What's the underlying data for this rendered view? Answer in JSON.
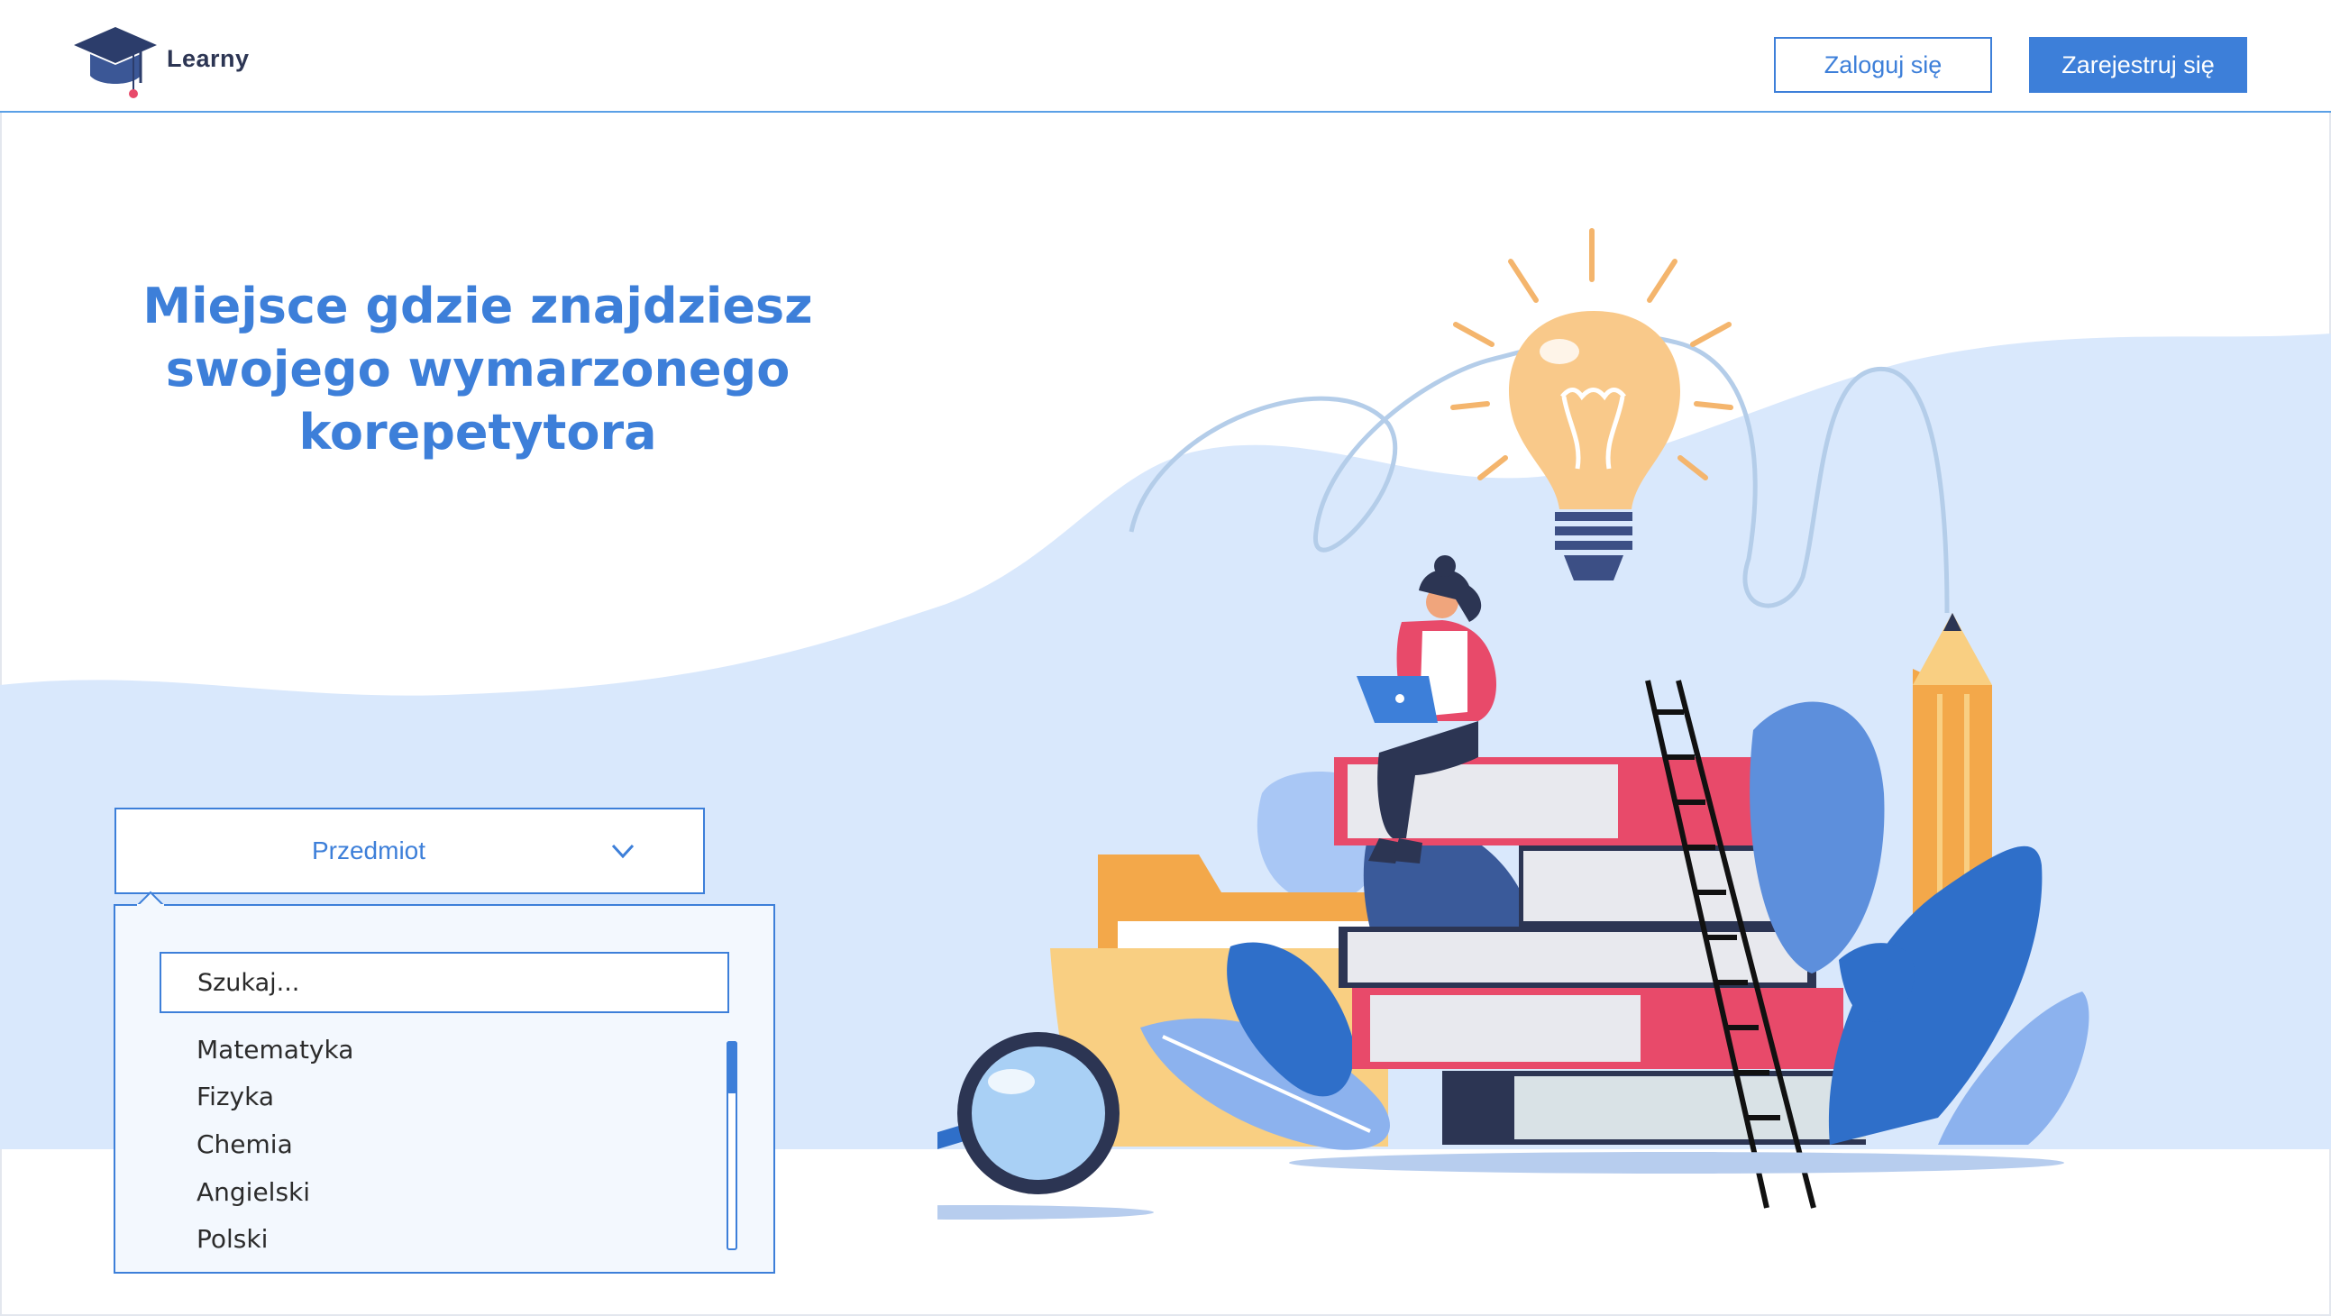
{
  "header": {
    "brand": "Learny",
    "login_label": "Zaloguj się",
    "register_label": "Zarejestruj się"
  },
  "hero": {
    "title_lines": [
      "Miejsce gdzie znajdziesz",
      "swojego wymarzonego",
      "korepetytora"
    ]
  },
  "subject_select": {
    "selected": "Przedmiot",
    "search_placeholder": "Szukaj...",
    "options": [
      "Matematyka",
      "Fizyka",
      "Chemia",
      "Angielski",
      "Polski"
    ]
  },
  "colors": {
    "accent": "#3d7fd9",
    "wave": "#d9e8fc",
    "text_dark": "#2c3553"
  },
  "icons": {
    "logo": "graduation-cap-icon",
    "select_chevron": "chevron-down-icon"
  }
}
